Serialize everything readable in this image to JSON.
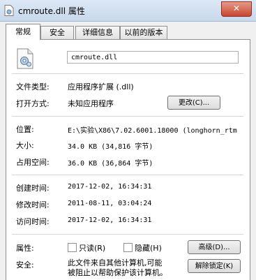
{
  "window": {
    "title": "cmroute.dll 属性",
    "close_label": "✕"
  },
  "tabs": [
    {
      "label": "常规"
    },
    {
      "label": "安全"
    },
    {
      "label": "详细信息"
    },
    {
      "label": "以前的版本"
    }
  ],
  "general": {
    "file_name": "cmroute.dll",
    "file_type_label": "文件类型:",
    "file_type_value": "应用程序扩展 (.dll)",
    "open_with_label": "打开方式:",
    "open_with_value": "未知应用程序",
    "change_button": "更改(C)...",
    "location_label": "位置:",
    "location_value": "E:\\实验\\X86\\7.02.6001.18000 (longhorn_rtm",
    "size_label": "大小:",
    "size_value": "34.0 KB (34,816 字节)",
    "size_on_disk_label": "占用空间:",
    "size_on_disk_value": "36.0 KB (36,864 字节)",
    "created_label": "创建时间:",
    "created_value": "2017-12-02, 16:34:31",
    "modified_label": "修改时间:",
    "modified_value": "2011-08-11, 03:04:24",
    "accessed_label": "访问时间:",
    "accessed_value": "2017-12-02, 16:34:31",
    "attributes_label": "属性:",
    "readonly_label": "只读(R)",
    "hidden_label": "隐藏(H)",
    "advanced_button": "高级(D)...",
    "security_label": "安全:",
    "security_text_line1": "此文件来自其他计算机,可能",
    "security_text_line2": "被阻止以帮助保护该计算机。",
    "unblock_button": "解除锁定(K)"
  }
}
